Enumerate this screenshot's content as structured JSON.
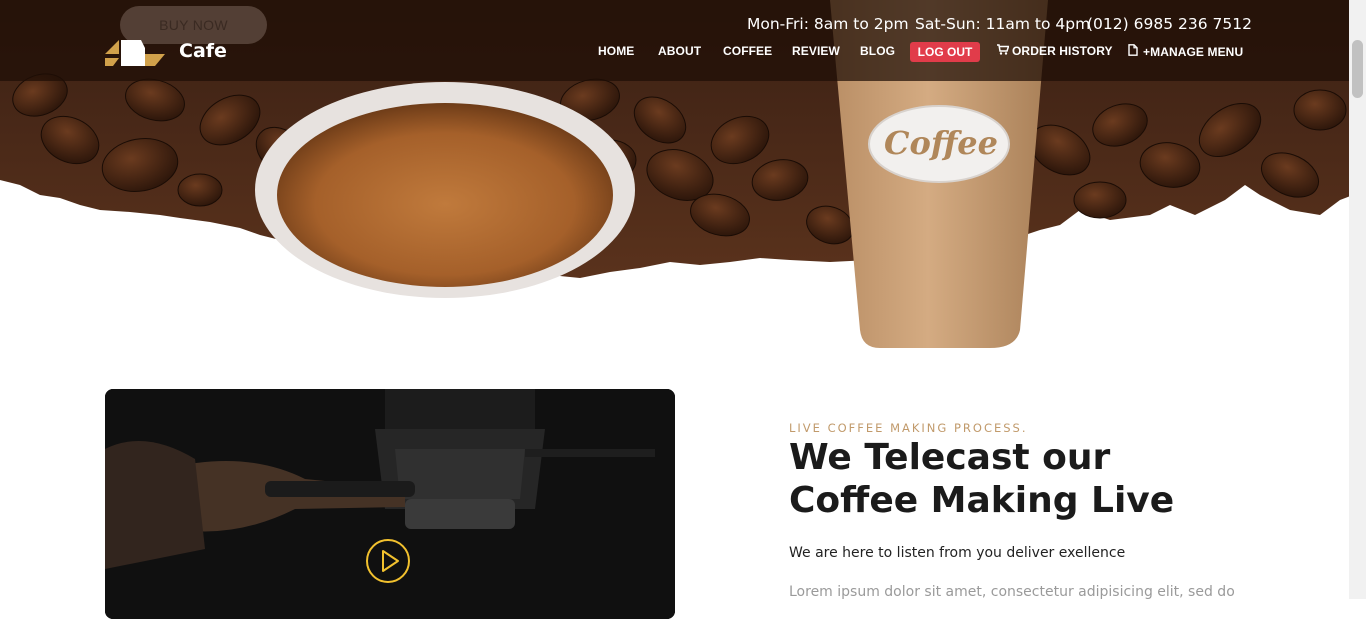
{
  "header": {
    "buy_now": "BUY NOW",
    "brand": "Cafe",
    "hours_weekday": "Mon-Fri: 8am to 2pm",
    "hours_weekend": "Sat-Sun: 11am to 4pm",
    "phone": "(012) 6985 236 7512"
  },
  "nav": {
    "home": "HOME",
    "about": "ABOUT",
    "coffee": "COFFEE",
    "review": "REVIEW",
    "blog": "BLOG",
    "logout": "LOG OUT",
    "order_history": "ORDER HISTORY",
    "manage_menu": "+MANAGE MENU",
    "order_history_icon": "cart-icon",
    "manage_menu_icon": "document-icon"
  },
  "hero": {
    "cup_label": "Coffee"
  },
  "live": {
    "eyebrow": "LIVE COFFEE MAKING PROCESS.",
    "headline_line1": "We Telecast our",
    "headline_line2": "Coffee Making Live",
    "tagline": "We are here to listen from you deliver exellence",
    "body": "Lorem ipsum dolor sit amet, consectetur adipisicing elit, sed do",
    "play_icon": "play-icon"
  },
  "colors": {
    "logout_bg": "#e13c4a",
    "accent_gold": "#c19a6b",
    "play_ring": "#f2c12e",
    "header_overlay": "#1e0e06"
  }
}
